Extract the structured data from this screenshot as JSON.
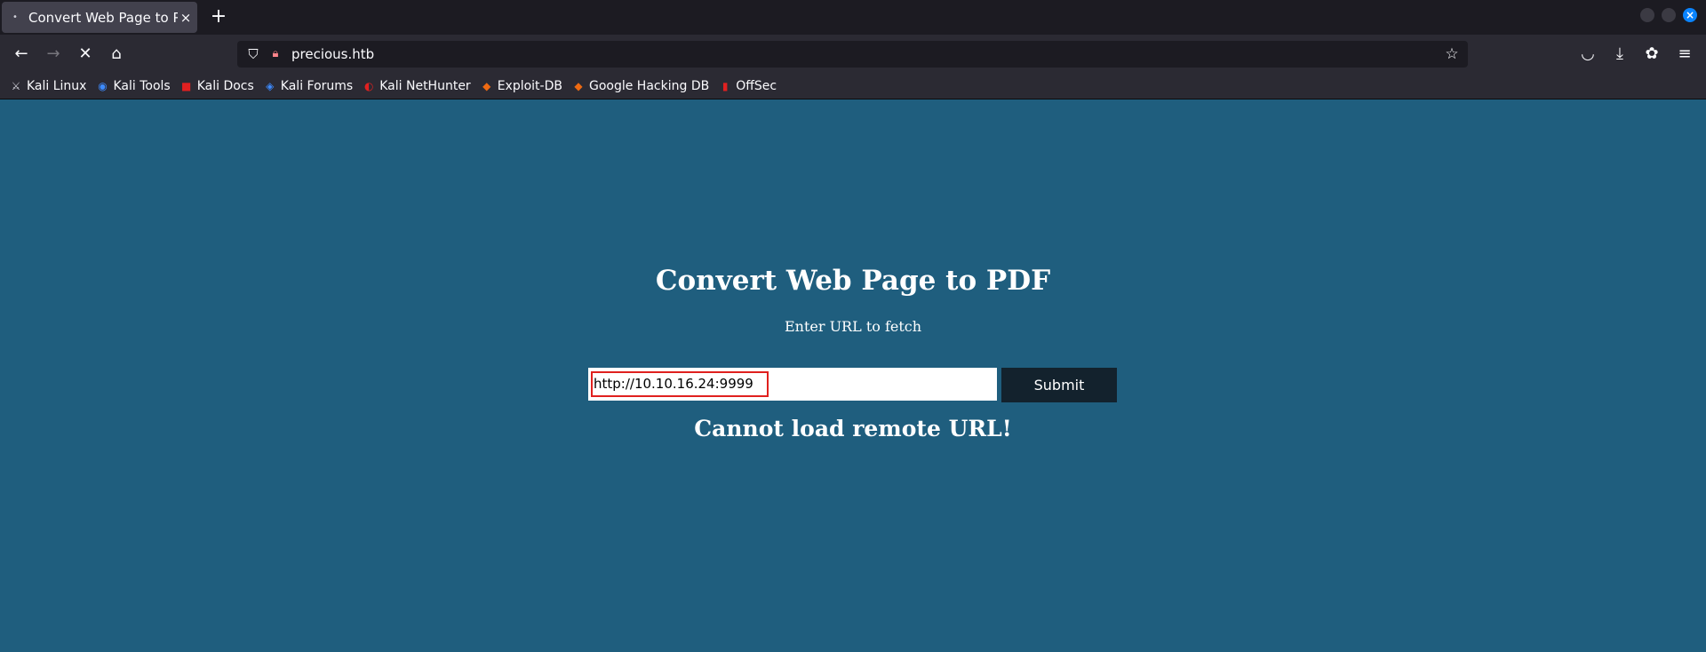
{
  "browser": {
    "tab": {
      "title": "Convert Web Page to PDF",
      "close_glyph": "×",
      "favicon": "•"
    },
    "new_tab_glyph": "+",
    "address": "precious.htb",
    "bookmarks": [
      {
        "label": "Kali Linux",
        "icon": "kali-linux-icon",
        "color": "#cfcfd8"
      },
      {
        "label": "Kali Tools",
        "icon": "kali-tools-icon",
        "color": "#3d8bff"
      },
      {
        "label": "Kali Docs",
        "icon": "kali-docs-icon",
        "color": "#e02020"
      },
      {
        "label": "Kali Forums",
        "icon": "kali-forums-icon",
        "color": "#3d8bff"
      },
      {
        "label": "Kali NetHunter",
        "icon": "kali-nethunter-icon",
        "color": "#e02020"
      },
      {
        "label": "Exploit-DB",
        "icon": "exploit-db-icon",
        "color": "#ee6a12"
      },
      {
        "label": "Google Hacking DB",
        "icon": "google-hacking-db-icon",
        "color": "#ee6a12"
      },
      {
        "label": "OffSec",
        "icon": "offsec-icon",
        "color": "#e02020"
      }
    ]
  },
  "page": {
    "heading": "Convert Web Page to PDF",
    "subheading": "Enter URL to fetch",
    "url_value": "http://10.10.16.24:9999",
    "submit_label": "Submit",
    "error_message": "Cannot load remote URL!",
    "background_color": "#1f5e7e",
    "highlight_color": "#e0201e"
  }
}
